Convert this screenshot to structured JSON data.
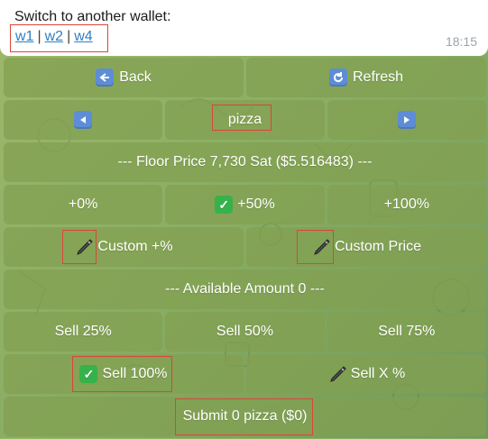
{
  "message": {
    "text": "Switch to another wallet:",
    "links": [
      "w1",
      "w2",
      "w4"
    ],
    "separator": "|",
    "time": "18:15"
  },
  "keyboard": {
    "back_label": "Back",
    "refresh_label": "Refresh",
    "token_label": "pizza",
    "floor_price_label": "--- Floor Price 7,730 Sat ($5.516483) ---",
    "pct_0": "+0%",
    "pct_50": "+50%",
    "pct_100": "+100%",
    "custom_pct_label": "Custom +%",
    "custom_price_label": "Custom Price",
    "available_label": "--- Available Amount 0 ---",
    "sell_25": "Sell 25%",
    "sell_50": "Sell 50%",
    "sell_75": "Sell 75%",
    "sell_100": "Sell 100%",
    "sell_x": "Sell X %",
    "submit_label": "Submit 0 pizza ($0)"
  },
  "colors": {
    "accent_link": "#2f7fc4",
    "check_green": "#36b24a",
    "nav_blue": "#5d8dd6",
    "highlight_red": "#d9463a"
  },
  "icons": {
    "back": "back-arrow-icon",
    "refresh": "refresh-icon",
    "prev": "left-triangle-icon",
    "next": "right-triangle-icon",
    "check": "check-mark-icon",
    "pen": "pen-icon"
  }
}
